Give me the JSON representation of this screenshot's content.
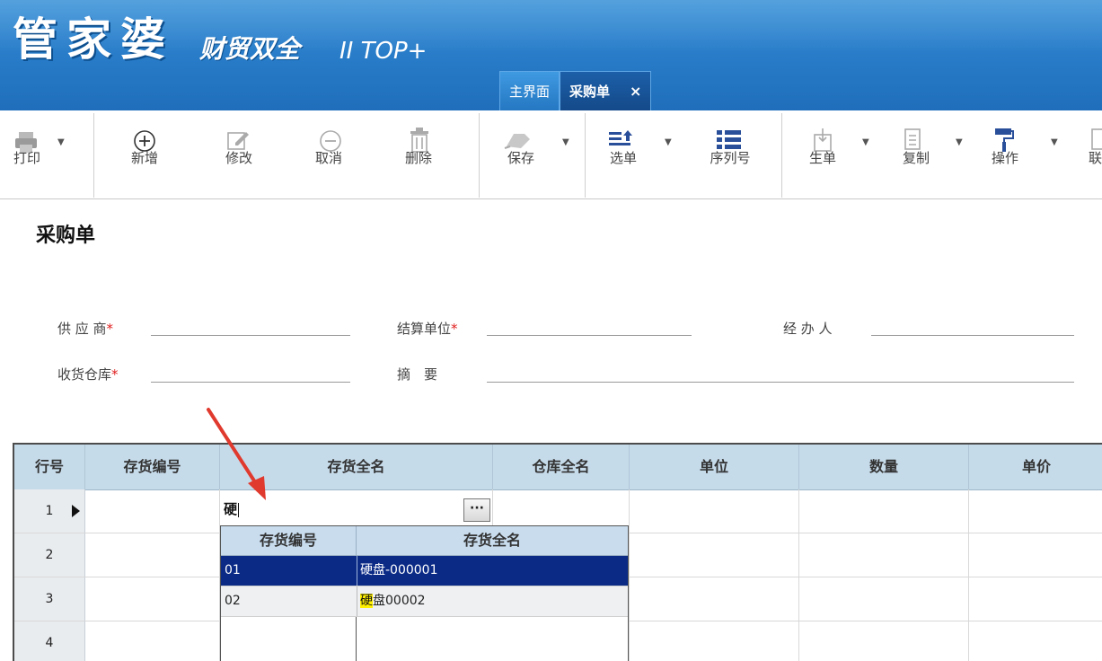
{
  "app": {
    "logo_main": "管家婆",
    "logo_sub": "财贸双全",
    "logo_version": "II TOP+"
  },
  "tabs": [
    {
      "label": "主界面",
      "active": false
    },
    {
      "label": "采购单",
      "active": true,
      "close": "×"
    }
  ],
  "toolbar": {
    "print": "打印",
    "add": "新增",
    "edit": "修改",
    "cancel": "取消",
    "delete": "删除",
    "save": "保存",
    "select_bill": "选单",
    "serial_no": "序列号",
    "generate": "生单",
    "copy": "复制",
    "operate": "操作",
    "link": "联"
  },
  "form": {
    "title": "采购单",
    "supplier_label": "供 应 商",
    "settle_label": "结算单位",
    "handler_label": "经 办 人",
    "warehouse_label": "收货仓库",
    "summary_label": "摘　要",
    "required_mark": "*"
  },
  "grid": {
    "columns": [
      "行号",
      "存货编号",
      "存货全名",
      "仓库全名",
      "单位",
      "数量",
      "单价"
    ],
    "rows": [
      {
        "no": "1"
      },
      {
        "no": "2"
      },
      {
        "no": "3"
      },
      {
        "no": "4"
      }
    ],
    "editing_value": "硬",
    "ellipsis": "···"
  },
  "dropdown": {
    "columns": [
      "存货编号",
      "存货全名"
    ],
    "items": [
      {
        "code": "01",
        "name_hl": "硬",
        "name_rest": "盘-000001",
        "selected": true
      },
      {
        "code": "02",
        "name_hl": "硬",
        "name_rest": "盘00002",
        "selected": false
      }
    ]
  },
  "colors": {
    "header_blue": "#2a7fcb",
    "selected_row": "#0a2a86",
    "highlight": "#fff000",
    "annotation_arrow": "#e03a2e"
  }
}
